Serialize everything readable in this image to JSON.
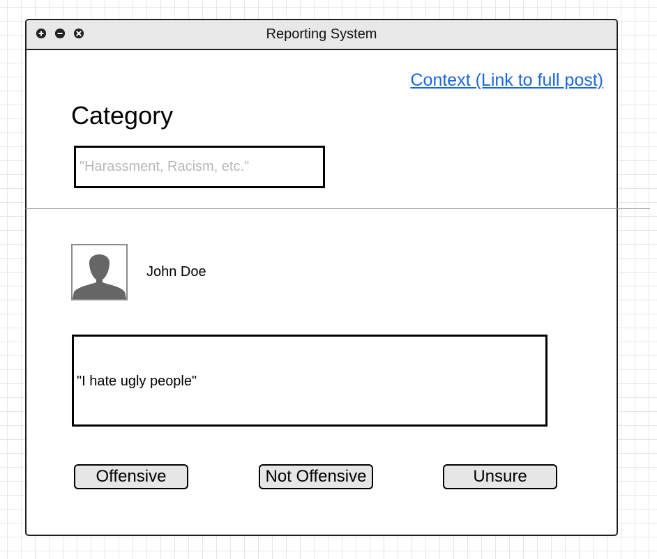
{
  "window": {
    "title": "Reporting System",
    "controls": [
      {
        "name": "maximize",
        "icon": "plus-icon"
      },
      {
        "name": "minimize",
        "icon": "minus-icon"
      },
      {
        "name": "close",
        "icon": "x-icon"
      }
    ]
  },
  "context_link": {
    "label": "Context (Link to full post)"
  },
  "category": {
    "heading": "Category",
    "placeholder": "\"Harassment, Racism, etc.\"",
    "value": ""
  },
  "post": {
    "author": "John Doe",
    "avatar_icon": "person-silhouette-icon",
    "text": "\"I hate ugly people\""
  },
  "actions": {
    "offensive": "Offensive",
    "not_offensive": "Not Offensive",
    "unsure": "Unsure"
  },
  "colors": {
    "link": "#1a66d9",
    "button_fill": "#e6e6e6",
    "titlebar": "#e8e8e8",
    "placeholder": "#b8b8b8",
    "avatar_silhouette": "#666666"
  }
}
